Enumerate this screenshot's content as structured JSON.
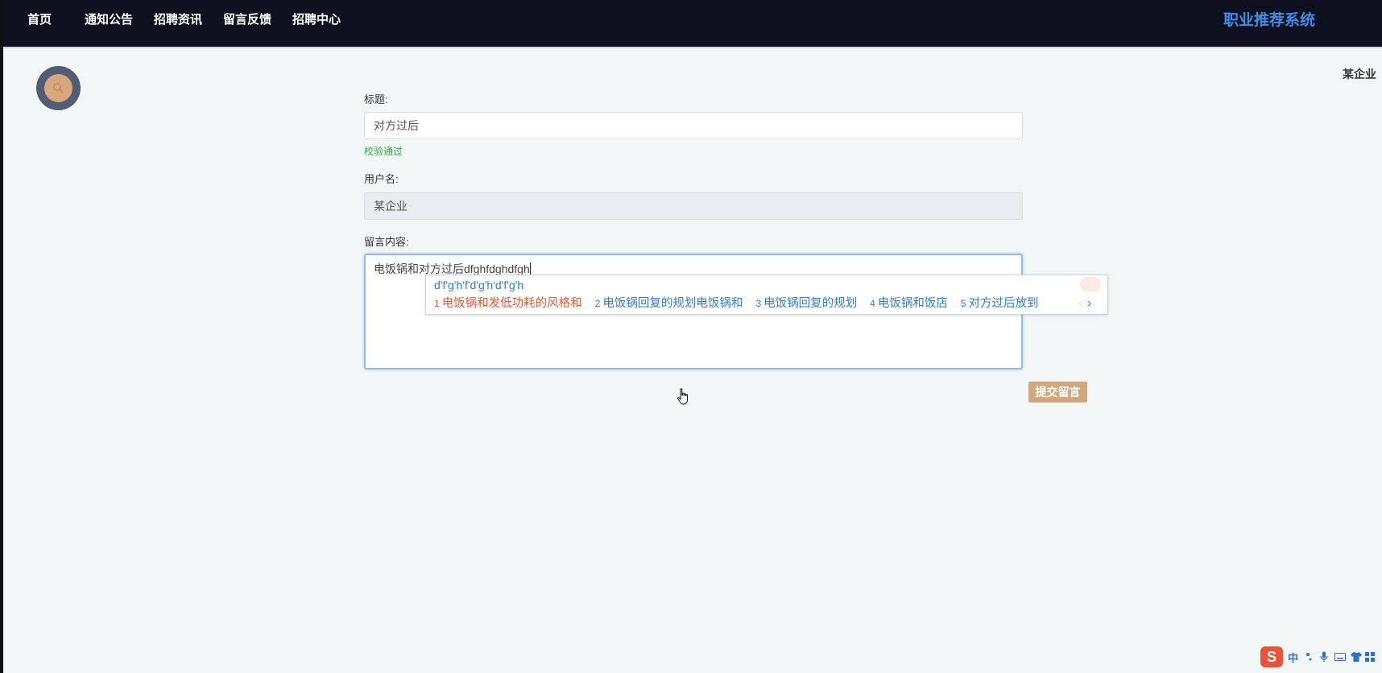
{
  "nav": {
    "items": [
      {
        "label": "首页"
      },
      {
        "label": "通知公告"
      },
      {
        "label": "招聘资讯"
      },
      {
        "label": "留言反馈"
      },
      {
        "label": "招聘中心"
      }
    ],
    "brand": "职业推荐系统"
  },
  "user": {
    "name": "某企业"
  },
  "form": {
    "title_label": "标题:",
    "title_value": "对方过后",
    "title_validation": "校验通过",
    "username_label": "用户名:",
    "username_value": "某企业",
    "content_label": "留言内容:",
    "content_value": "电饭锅和对方过后dfghfdghdfgh",
    "submit_label": "提交留言"
  },
  "ime": {
    "pinyin": "d'f'g'h'f'd'g'h'd'f'g'h",
    "candidates": [
      {
        "num": "1",
        "text": "电饭锅和发低功耗的风格和"
      },
      {
        "num": "2",
        "text": "电饭锅回复的规划电饭锅和"
      },
      {
        "num": "3",
        "text": "电饭锅回复的规划"
      },
      {
        "num": "4",
        "text": "电饭锅和饭店"
      },
      {
        "num": "5",
        "text": "对方过后放到"
      }
    ],
    "prev": "‹",
    "next": "›"
  },
  "tray": {
    "logo": "S",
    "lang": "中"
  },
  "colors": {
    "navbar": "#0f1020",
    "brand": "#3c8ee8",
    "accent": "#d3a77c",
    "valid": "#3aa04a",
    "ime_active": "#e55a3a"
  },
  "icons": [
    "search-icon",
    "hand-cursor-icon",
    "sogou-logo-icon",
    "mic-icon",
    "keyboard-icon"
  ]
}
